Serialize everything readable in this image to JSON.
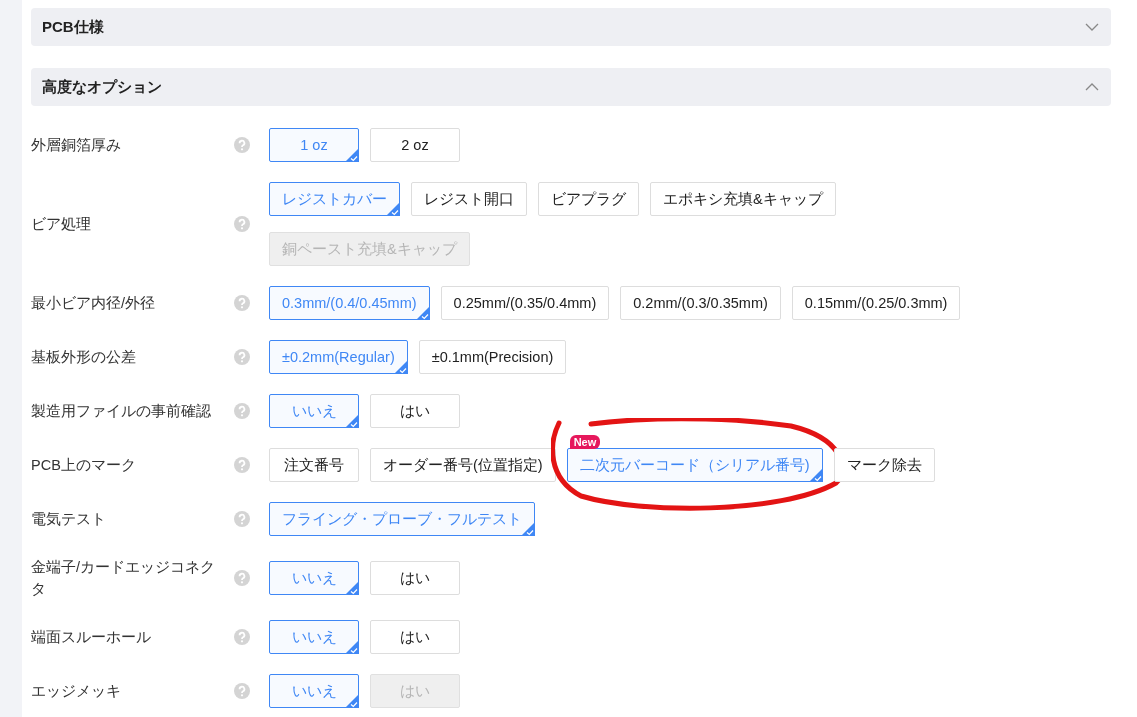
{
  "sections": [
    {
      "title": "PCB仕様",
      "expanded": false
    },
    {
      "title": "高度なオプション",
      "expanded": true
    }
  ],
  "options": [
    {
      "label": "外層銅箔厚み",
      "choices": [
        {
          "text": "1 oz",
          "selected": true,
          "disabled": false
        },
        {
          "text": "2 oz",
          "selected": false,
          "disabled": false
        }
      ]
    },
    {
      "label": "ビア処理",
      "choices": [
        {
          "text": "レジストカバー",
          "selected": true,
          "disabled": false
        },
        {
          "text": "レジスト開口",
          "selected": false,
          "disabled": false
        },
        {
          "text": "ビアプラグ",
          "selected": false,
          "disabled": false
        },
        {
          "text": "エポキシ充填&キャップ",
          "selected": false,
          "disabled": false
        },
        {
          "text": "銅ペースト充填&キャップ",
          "selected": false,
          "disabled": true
        }
      ]
    },
    {
      "label": "最小ビア内径/外径",
      "choices": [
        {
          "text": "0.3mm/(0.4/0.45mm)",
          "selected": true,
          "disabled": false
        },
        {
          "text": "0.25mm/(0.35/0.4mm)",
          "selected": false,
          "disabled": false
        },
        {
          "text": "0.2mm/(0.3/0.35mm)",
          "selected": false,
          "disabled": false
        },
        {
          "text": "0.15mm/(0.25/0.3mm)",
          "selected": false,
          "disabled": false
        }
      ]
    },
    {
      "label": "基板外形の公差",
      "choices": [
        {
          "text": "±0.2mm(Regular)",
          "selected": true,
          "disabled": false
        },
        {
          "text": "±0.1mm(Precision)",
          "selected": false,
          "disabled": false
        }
      ]
    },
    {
      "label": "製造用ファイルの事前確認",
      "choices": [
        {
          "text": "いいえ",
          "selected": true,
          "disabled": false
        },
        {
          "text": "はい",
          "selected": false,
          "disabled": false
        }
      ]
    },
    {
      "label": "PCB上のマーク",
      "choices": [
        {
          "text": "注文番号",
          "selected": false,
          "disabled": false
        },
        {
          "text": "オーダー番号(位置指定)",
          "selected": false,
          "disabled": false
        },
        {
          "text": "二次元バーコード（シリアル番号)",
          "selected": true,
          "disabled": false,
          "badge": "New",
          "circled": true
        },
        {
          "text": "マーク除去",
          "selected": false,
          "disabled": false
        }
      ]
    },
    {
      "label": "電気テスト",
      "choices": [
        {
          "text": "フライング・プローブ・フルテスト",
          "selected": true,
          "disabled": false
        }
      ]
    },
    {
      "label": "金端子/カードエッジコネクタ",
      "choices": [
        {
          "text": "いいえ",
          "selected": true,
          "disabled": false
        },
        {
          "text": "はい",
          "selected": false,
          "disabled": false
        }
      ]
    },
    {
      "label": "端面スルーホール",
      "choices": [
        {
          "text": "いいえ",
          "selected": true,
          "disabled": false
        },
        {
          "text": "はい",
          "selected": false,
          "disabled": false
        }
      ]
    },
    {
      "label": "エッジメッキ",
      "choices": [
        {
          "text": "いいえ",
          "selected": true,
          "disabled": false
        },
        {
          "text": "はい",
          "selected": false,
          "disabled": true
        }
      ]
    }
  ]
}
